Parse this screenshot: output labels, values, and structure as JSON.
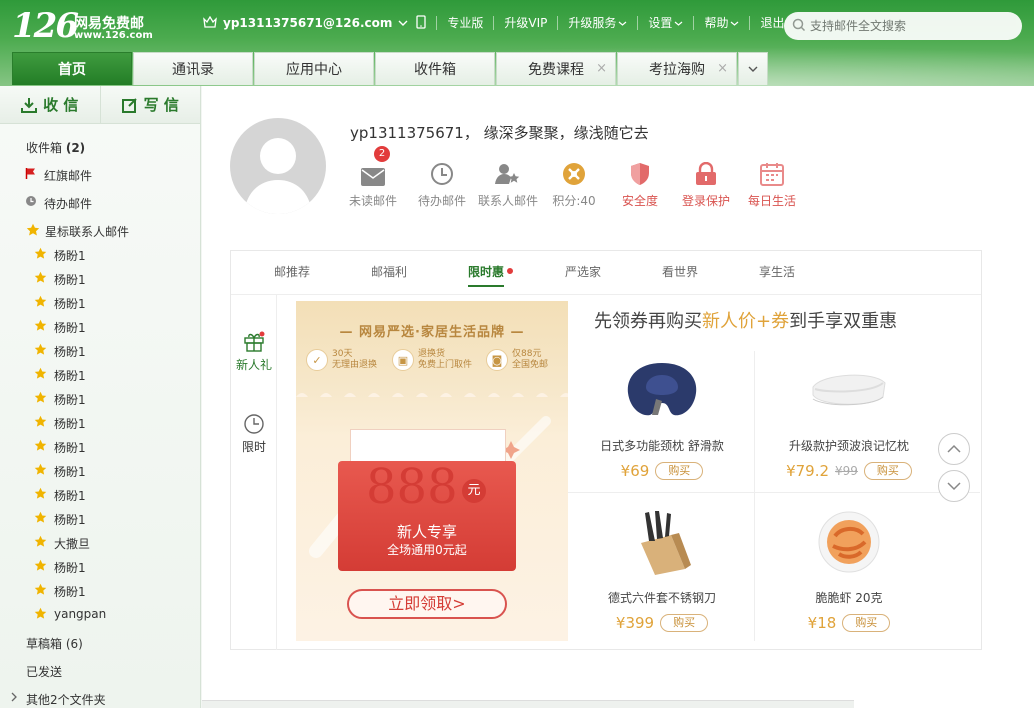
{
  "header": {
    "logo_number": "126",
    "logo_text": "网易免费邮",
    "logo_url": "www.126.com",
    "email": "yp1311375671@126.com",
    "links": [
      "专业版",
      "升级VIP",
      "升级服务",
      "设置",
      "帮助",
      "退出"
    ],
    "search_placeholder": "支持邮件全文搜索"
  },
  "tabs": [
    {
      "label": "首页"
    },
    {
      "label": "通讯录"
    },
    {
      "label": "应用中心"
    },
    {
      "label": "收件箱"
    },
    {
      "label": "免费课程"
    },
    {
      "label": "考拉海购"
    }
  ],
  "sidebar": {
    "receive": "收 信",
    "compose": "写 信",
    "inbox_label": "收件箱",
    "inbox_count": "(2)",
    "flagged": "红旗邮件",
    "todo": "待办邮件",
    "starred": "星标联系人邮件",
    "contacts": [
      "杨盼1",
      "杨盼1",
      "杨盼1",
      "杨盼1",
      "杨盼1",
      "杨盼1",
      "杨盼1",
      "杨盼1",
      "杨盼1",
      "杨盼1",
      "杨盼1",
      "杨盼1",
      "大撒旦",
      "杨盼1",
      "杨盼1",
      "yangpan"
    ],
    "drafts": "草稿箱 (6)",
    "sent": "已发送",
    "others": "其他2个文件夹"
  },
  "profile": {
    "greeting": "yp1311375671， 缘深多聚聚，缘浅随它去",
    "unread_badge": "2",
    "stats": [
      "未读邮件",
      "待办邮件",
      "联系人邮件",
      "积分:40",
      "安全度",
      "登录保护",
      "每日生活"
    ]
  },
  "panel": {
    "tabs": [
      "邮推荐",
      "邮福利",
      "限时惠",
      "严选家",
      "看世界",
      "享生活"
    ],
    "side_nav": [
      "新人礼",
      "限时"
    ],
    "promo": {
      "title": "网易严选·家居生活品牌",
      "features": [
        {
          "l1": "30天",
          "l2": "无理由退换"
        },
        {
          "l1": "退换货",
          "l2": "免费上门取件"
        },
        {
          "l1": "仅88元",
          "l2": "全国免邮"
        }
      ],
      "amount": "888",
      "yuan": "元",
      "new_user": "新人专享",
      "subtitle": "全场通用0元起",
      "claim": "立即领取>"
    },
    "headline_a": "先领券再购买",
    "headline_b": "新人价+券",
    "headline_c": "到手享双重惠",
    "products": [
      {
        "name": "日式多功能颈枕 舒滑款",
        "price": "¥69",
        "old": "",
        "buy": "购买"
      },
      {
        "name": "升级款护颈波浪记忆枕",
        "price": "¥79.2",
        "old": "¥99",
        "buy": "购买"
      },
      {
        "name": "德式六件套不锈钢刀",
        "price": "¥399",
        "old": "",
        "buy": "购买"
      },
      {
        "name": "脆脆虾 20克",
        "price": "¥18",
        "old": "",
        "buy": "购买"
      }
    ]
  },
  "colors": {
    "brand_green": "#2a7a2c",
    "accent_gold": "#e0a33a",
    "red": "#d43c35"
  }
}
